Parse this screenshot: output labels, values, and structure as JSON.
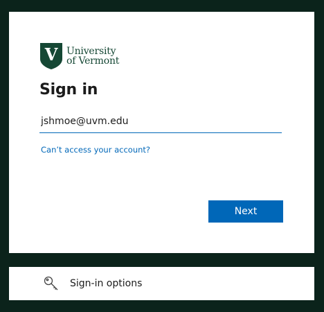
{
  "brand": {
    "line1": "University",
    "line2": "of Vermont",
    "shield_letter": "V",
    "color": "#154734"
  },
  "signin": {
    "title": "Sign in",
    "email_value": "jshmoe@uvm.edu",
    "cant_access_link": "Can’t access your account?",
    "next_label": "Next"
  },
  "options": {
    "label": "Sign-in options",
    "icon": "key-icon"
  },
  "colors": {
    "accent": "#0067b8",
    "background": "#0b231b"
  }
}
